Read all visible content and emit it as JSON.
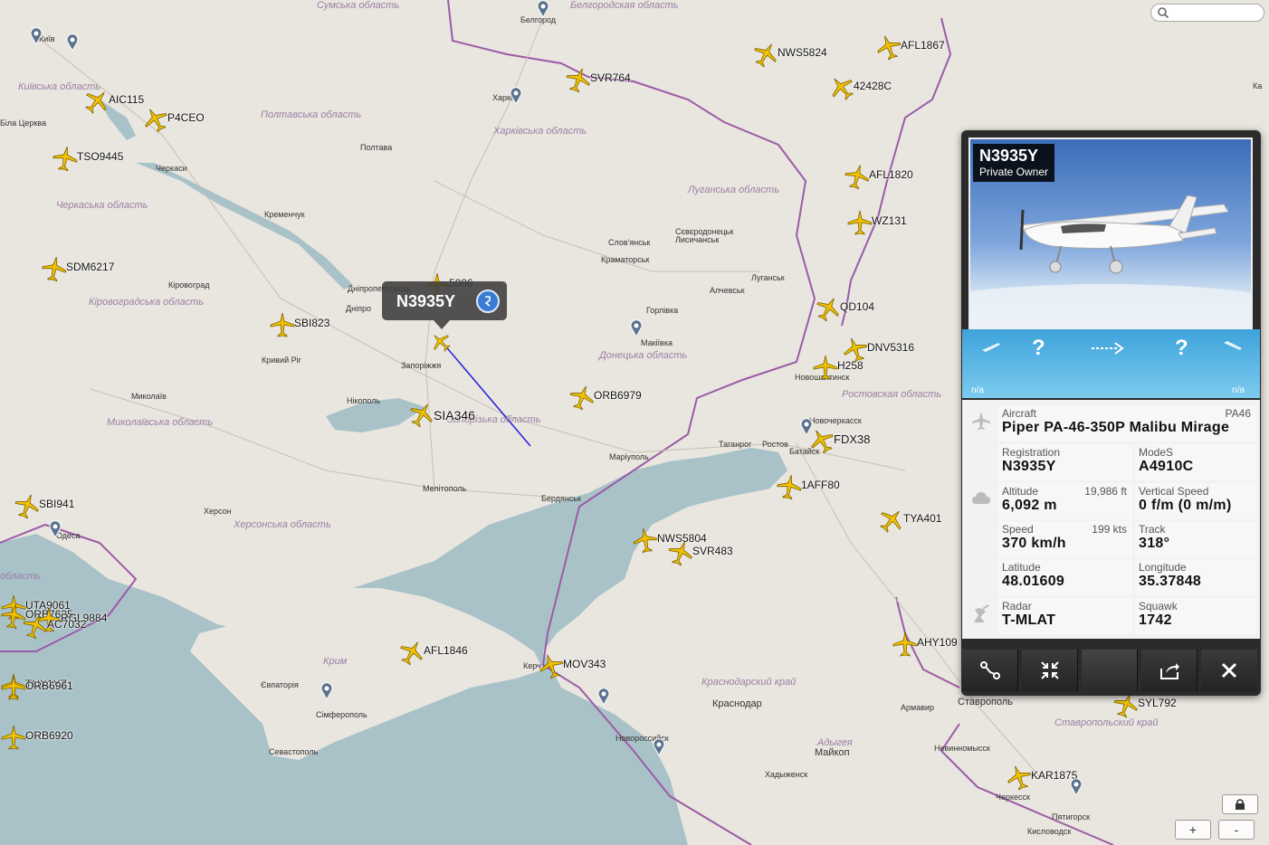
{
  "search": {
    "placeholder": ""
  },
  "cities": [
    "Київ",
    "Белгород",
    "Біла Церква",
    "Полтава",
    "Черкаси",
    "Кременчук",
    "Кіровоград",
    "Дніпропетровськ",
    "Дніпро",
    "Харків",
    "Слов'янськ",
    "Сєвєродонецьк",
    "Лисичанськ",
    "Краматорськ",
    "Луганськ",
    "Алчевськ",
    "Горлівка",
    "Макіївка",
    "Запоріжжя",
    "Кривий Ріг",
    "Нікополь",
    "Миколаїв",
    "Херсон",
    "Мелітополь",
    "Маріуполь",
    "Бердянськ",
    "Таганрог",
    "Новочеркасск",
    "Новошахтинск",
    "Батайск",
    "Ростов",
    "Керч",
    "Євпаторія",
    "Сімферополь",
    "Севастополь",
    "Новороссийск",
    "Краснодар",
    "Майкоп",
    "Хадыженск",
    "Армавир",
    "Ставрополь",
    "Невинномысск",
    "Черкесск",
    "Пятигорск",
    "Кисловодск",
    "Одеса",
    "Ка"
  ],
  "regions": [
    "Київська область",
    "Полтавська область",
    "Харківська область",
    "Черкаська область",
    "Луганська область",
    "Кіровоградська область",
    "Донецька область",
    "Миколаївська область",
    "Запорізька область",
    "Херсонська область",
    "Ростовская область",
    "Крим",
    "Краснодарский край",
    "Адыгея",
    "Ставропольский край",
    "область",
    "Сумська область",
    "Белгородская область"
  ],
  "flights": [
    "AFL1867",
    "NWS5824",
    "42428C",
    "SVR764",
    "AIC115",
    "P4CEO",
    "TSO9445",
    "AFL1820",
    "WZ131",
    "SDM6217",
    "QD104",
    "SBI823",
    "DNV5316",
    "H258",
    "ORB6979",
    "SIA346",
    "FDX38",
    "1AFF80",
    "SBI941",
    "TYA401",
    "NWS5804",
    "SVR483",
    "UTA9061",
    "ORB7635",
    "RGL9884",
    "AC7032",
    "AFL1846",
    "MOV343",
    "AHY109",
    "TUX1YZ",
    "ORB6961",
    "ORB6920",
    "SYL792",
    "KAR1875",
    "5086"
  ],
  "selected": {
    "callsign": "N3935Y",
    "owner": "Private Owner",
    "route": {
      "from": "?",
      "to": "?",
      "from_time": "n/a",
      "to_time": "n/a"
    },
    "aircraft_label": "Aircraft",
    "aircraft_code": "PA46",
    "aircraft": "Piper PA-46-350P Malibu Mirage",
    "registration_label": "Registration",
    "registration": "N3935Y",
    "modes_label": "ModeS",
    "modes": "A4910C",
    "altitude_label": "Altitude",
    "altitude_ft": "19,986 ft",
    "altitude": "6,092 m",
    "vspeed_label": "Vertical Speed",
    "vspeed": "0 f/m (0 m/m)",
    "speed_label": "Speed",
    "speed_kts": "199 kts",
    "speed": "370 km/h",
    "track_label": "Track",
    "track": "318°",
    "lat_label": "Latitude",
    "lat": "48.01609",
    "lon_label": "Longitude",
    "lon": "35.37848",
    "radar_label": "Radar",
    "radar": "T-MLAT",
    "squawk_label": "Squawk",
    "squawk": "1742"
  },
  "zoom": {
    "in": "+",
    "out": "-"
  },
  "colors": {
    "sea": "#a9c2c8",
    "land": "#e9e5df",
    "border": "#9b5ba6",
    "plane": "#f2c200",
    "track": "#2222dd",
    "panel_accent": "#3ea3db"
  }
}
